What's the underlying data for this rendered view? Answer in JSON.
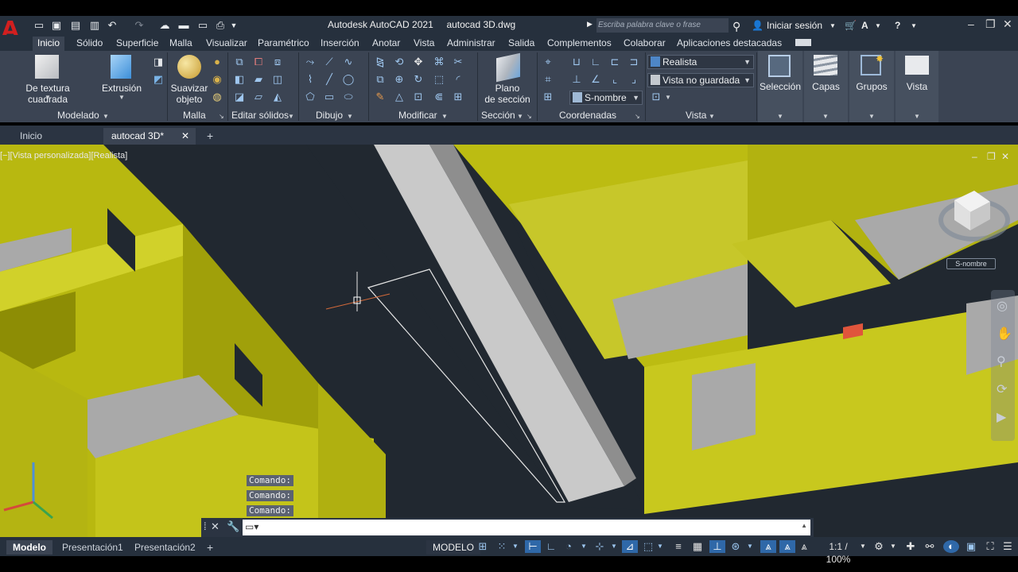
{
  "app": {
    "logo": "A",
    "title": "Autodesk AutoCAD 2021",
    "file": "autocad 3D.dwg",
    "search_placeholder": "Escriba palabra clave o frase",
    "signin": "Iniciar sesión"
  },
  "ribbon_tabs": [
    "Inicio",
    "Sólido",
    "Superficie",
    "Malla",
    "Visualizar",
    "Paramétrico",
    "Inserción",
    "Anotar",
    "Vista",
    "Administrar",
    "Salida",
    "Complementos",
    "Colaborar",
    "Aplicaciones destacadas"
  ],
  "ribbon": {
    "modelado": {
      "label": "Modelado",
      "box_btn": "De textura cuadrada",
      "extrude_btn": "Extrusión"
    },
    "malla": {
      "label": "Malla",
      "smooth_btn_line1": "Suavizar",
      "smooth_btn_line2": "objeto"
    },
    "editar": {
      "label": "Editar sólidos"
    },
    "dibujo": {
      "label": "Dibujo"
    },
    "modificar": {
      "label": "Modificar"
    },
    "seccion": {
      "label": "Sección",
      "plane_btn_line1": "Plano",
      "plane_btn_line2": "de sección"
    },
    "coordenadas": {
      "label": "Coordenadas",
      "ucs_dropdown": "S-nombre"
    },
    "vista": {
      "label": "Vista",
      "visual_style": "Realista",
      "saved_view": "Vista no guardada"
    },
    "seleccion": "Selección",
    "capas": "Capas",
    "grupos": "Grupos",
    "vista_btn": "Vista"
  },
  "doc_tabs": [
    "Inicio",
    "autocad 3D*"
  ],
  "viewport": {
    "label": "[−][Vista personalizada][Realista]",
    "viewcube_ucs": "S-nombre",
    "command_history": [
      "Comando:",
      "Comando:",
      "Comando:"
    ]
  },
  "status": {
    "layout_tabs": [
      "Modelo",
      "Presentación1",
      "Presentación2"
    ],
    "model_button": "MODELO",
    "scale": "1:1 / 100%"
  },
  "colors": {
    "wall_yellow": "#c8c81e",
    "wall_shade": "#9a9a0a",
    "floor_gray": "#a9a9a9",
    "background": "#212830",
    "accent_blue": "#2f68a8"
  }
}
